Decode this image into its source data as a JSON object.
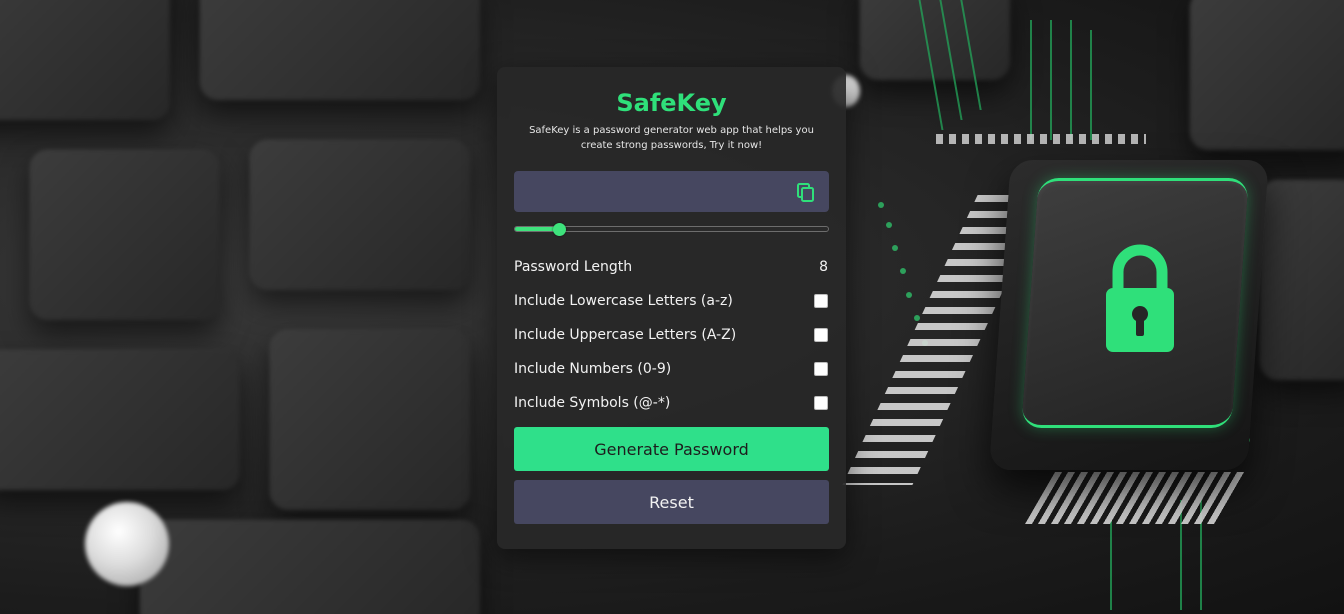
{
  "app": {
    "title": "SafeKey",
    "description": "SafeKey is a password generator web app that helps you create strong passwords, Try it now!"
  },
  "password_output": {
    "value": "",
    "copy_icon": "copy-icon"
  },
  "length_slider": {
    "min": 4,
    "max": 32,
    "value": 8
  },
  "options": {
    "length_label": "Password Length",
    "length_value": "8",
    "lowercase_label": "Include Lowercase Letters (a-z)",
    "uppercase_label": "Include Uppercase Letters (A-Z)",
    "numbers_label": "Include Numbers (0-9)",
    "symbols_label": "Include Symbols (@-*)"
  },
  "buttons": {
    "generate_label": "Generate Password",
    "reset_label": "Reset"
  },
  "colors": {
    "accent": "#2fe08a",
    "field_bg": "#464760",
    "card_bg": "#282828"
  }
}
